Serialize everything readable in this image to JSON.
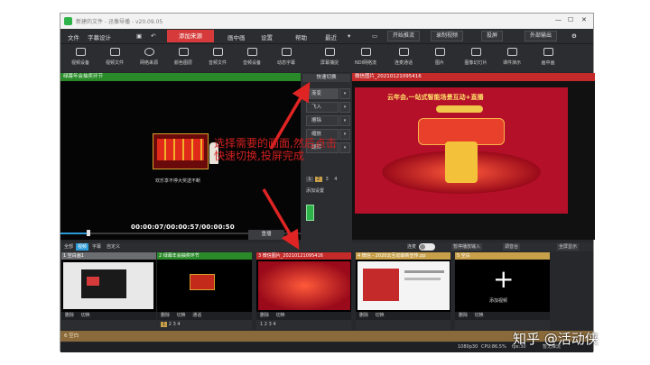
{
  "window": {
    "title": "新建的文件 - 迅像导播 - v20.09.05"
  },
  "menu": {
    "items": [
      "文件",
      "字幕设计",
      "添加来源",
      "画中画",
      "设置",
      "帮助",
      "最近"
    ],
    "start_stream": "开始推流",
    "record": "录制视频",
    "project": "投屏",
    "output": "外部输出"
  },
  "toolbar": {
    "tools": [
      "视频设备",
      "视频文件",
      "网络来源",
      "颜色图层",
      "音频文件",
      "音频设备",
      "动态字幕",
      "屏幕捕捉",
      "NDI网络流",
      "连麦通话",
      "图片",
      "图像幻灯片",
      "课件演示",
      "画中画"
    ]
  },
  "preview": {
    "header": "绿幕年会抽奖环节",
    "timecode": "00:00:07/00:00:57/00:00:50",
    "caption": "欢乐享不停大奖送不断",
    "replay": "重播"
  },
  "program": {
    "header": "微信图片_20210121095416",
    "poster_title": "云年会,一站式智能场景互动+直播"
  },
  "controls": {
    "quick_switch": "快速切换",
    "transitions": [
      "渐变",
      "飞入",
      "擦除",
      "缩放",
      "翻转"
    ],
    "add_setting": "添加设置",
    "pages": [
      "1",
      "2",
      "3",
      "4"
    ]
  },
  "annotation": {
    "text": "选择需要的画面,然后点击快速切换,投屏完成"
  },
  "tabs": {
    "items": [
      "全部",
      "视频",
      "字幕",
      "自定义"
    ],
    "link": "连麦",
    "pause_input": "暂停播放输入",
    "audio_table": "调音台",
    "fullscreen": "全屏显示"
  },
  "cards": [
    {
      "header": "1 空白画1",
      "buttons": [
        "删除",
        "切换"
      ]
    },
    {
      "header": "2 绿幕年会抽奖环节",
      "buttons": [
        "删除",
        "切换",
        "通话"
      ]
    },
    {
      "header": "3 微信图片_20210121095416",
      "buttons": [
        "删除",
        "切换"
      ]
    },
    {
      "header": "4 微信 - 2020云互动最新宣传.pp",
      "buttons": [
        "删除",
        "切换"
      ]
    },
    {
      "header": "5 空白",
      "buttons": [
        "删除",
        "切换"
      ],
      "add_label": "添加视频"
    }
  ],
  "bottom_strip": "6 空白",
  "status": {
    "resolution": "1080p30",
    "cpu": "CPU:86.5%",
    "fps": "fps:30",
    "lock": "暂无推流"
  },
  "watermark": "知乎 @活动侠",
  "colors": {
    "accent_red": "#d63a3a",
    "preview_green": "#2a8a2a",
    "program_red": "#c42a2a",
    "card_gold": "#c9a04a"
  }
}
